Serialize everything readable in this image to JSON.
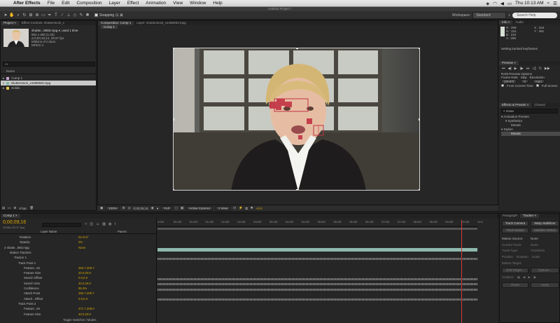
{
  "menubar": {
    "app_name": "After Effects",
    "items": [
      "File",
      "Edit",
      "Composition",
      "Layer",
      "Effect",
      "Animation",
      "View",
      "Window",
      "Help"
    ],
    "clock": "Thu 10:13 AM"
  },
  "window_title": "Untitled Project *",
  "toolbar": {
    "snapping_label": "Snapping",
    "workspace_label": "Workspace:",
    "workspace_value": "Standard",
    "search_placeholder": "Search Help"
  },
  "project_panel": {
    "tab_project": "Project ×",
    "tab_effect_controls": "Effect Controls: shutterstock_x",
    "footage_name": "shutter...8083.mpg ▾, used 1 time",
    "footage_info": [
      "852 x 480 (1.00)",
      "Δ 0;00;15;14, 29.97 fps",
      "Millions of Colors",
      "MPEG-1"
    ],
    "search_placeholder": "",
    "column_name": "Name",
    "items": [
      {
        "name": "Comp 1",
        "color": "#c9a6d6",
        "selected": false
      },
      {
        "name": "shutterstock_v4488083.mpg",
        "color": "#7fb5a3",
        "selected": true
      },
      {
        "name": "Solids",
        "color": "#e3c34c",
        "selected": false
      }
    ],
    "bpc": "8 bpc"
  },
  "comp_panel": {
    "tab": "Composition: Comp 1",
    "layer_tab": "Layer: shutterstock_v4488083.mpg",
    "subtab": "Comp 1",
    "zoom": "100%",
    "timecode": "0;00;09;16",
    "resolution": "Full",
    "camera": "Active Camera",
    "views": "1 View",
    "exposure": "+0.0"
  },
  "info_panel": {
    "tab_info": "Info ×",
    "tab_audio": "Audio",
    "r": "R : 209",
    "g": "G : 221",
    "b": "B : 210",
    "a": "A : 255",
    "x": "X : 434",
    "y": "Y : 461",
    "status": "Setting tracked keyframes"
  },
  "preview_panel": {
    "tab": "Preview ×",
    "ram_options": "RAM Preview Options",
    "frame_rate_label": "Frame Rate",
    "skip_label": "Skip",
    "resolution_label": "Resolution",
    "frame_rate_value": "(29.97)",
    "skip_value": "0",
    "resolution_value": "Auto",
    "from_current": "From Current Time",
    "full_screen": "Full Screen"
  },
  "effects_panel": {
    "tab": "Effects & Presets ×",
    "tab2": "Charact",
    "search_value": "mosa",
    "tree": [
      "▾ Animation Presets",
      "▾ Synthetics",
      "Mosaic",
      "▾ Stylize",
      "Mosaic"
    ]
  },
  "timeline": {
    "tab": "Comp 1 ×",
    "timecode": "0;00;09;16",
    "fps": "00286 (29.97 fps)",
    "col_layer_name": "Layer Name",
    "col_parent": "Parent",
    "ticks": [
      "0:00f",
      "00:15f",
      "01:00f",
      "01:15f",
      "02:00f",
      "02:15f",
      "03:00f",
      "03:15f",
      "04:00f",
      "04:15f",
      "05:00f",
      "05:15f",
      "06:00f",
      "06:15f",
      "07:00f",
      "07:15f",
      "08:00f",
      "08:15f",
      "09:00f",
      "09:15f",
      "10:0"
    ],
    "rows": [
      {
        "key": "Rotation",
        "val": "0x+0.0°"
      },
      {
        "key": "Opacity",
        "val": "0%"
      },
      {
        "key": "2   shutte...083.mpg",
        "val": "None"
      },
      {
        "key": "Motion Trackers",
        "val": ""
      },
      {
        "key": "Tracker 1",
        "val": ""
      },
      {
        "key": "Track Point 1",
        "val": ""
      },
      {
        "key": "Feature...ter",
        "val": "393.7,209.7"
      },
      {
        "key": "Feature Size",
        "val": "20.0,20.0"
      },
      {
        "key": "Search Offset",
        "val": "0.0,0.0"
      },
      {
        "key": "Search Size",
        "val": "40.0,40.0"
      },
      {
        "key": "Confidence",
        "val": "95.2%"
      },
      {
        "key": "Attach Point",
        "val": "393.7,209.7"
      },
      {
        "key": "Attach...Offset",
        "val": "0.0,0.0"
      },
      {
        "key": "Track Point 2",
        "val": ""
      },
      {
        "key": "Feature...ter",
        "val": "471.7,208.0"
      },
      {
        "key": "Feature Size",
        "val": "20.0,20.0"
      }
    ],
    "footer": "Toggle Switches / Modes",
    "playhead_fraction": 0.95
  },
  "tracker_panel": {
    "tab_paragraph": "Paragraph",
    "tab_tracker": "Tracker ×",
    "track_camera": "Track Camera",
    "warp_stabilizer": "Warp Stabilizer",
    "track_motion": "Track Motion",
    "stabilize_motion": "Stabilize Motion",
    "motion_source_label": "Motion Source:",
    "motion_source_value": "None",
    "current_track_label": "Current Track:",
    "current_track_value": "None",
    "track_type_label": "Track Type:",
    "track_type_value": "Transform",
    "position": "Position",
    "rotation": "Rotation",
    "scale": "Scale",
    "motion_target": "Motion Target:",
    "edit_target": "Edit Target...",
    "options": "Options...",
    "analyze": "Analyze:",
    "reset": "Reset",
    "apply": "Apply"
  }
}
